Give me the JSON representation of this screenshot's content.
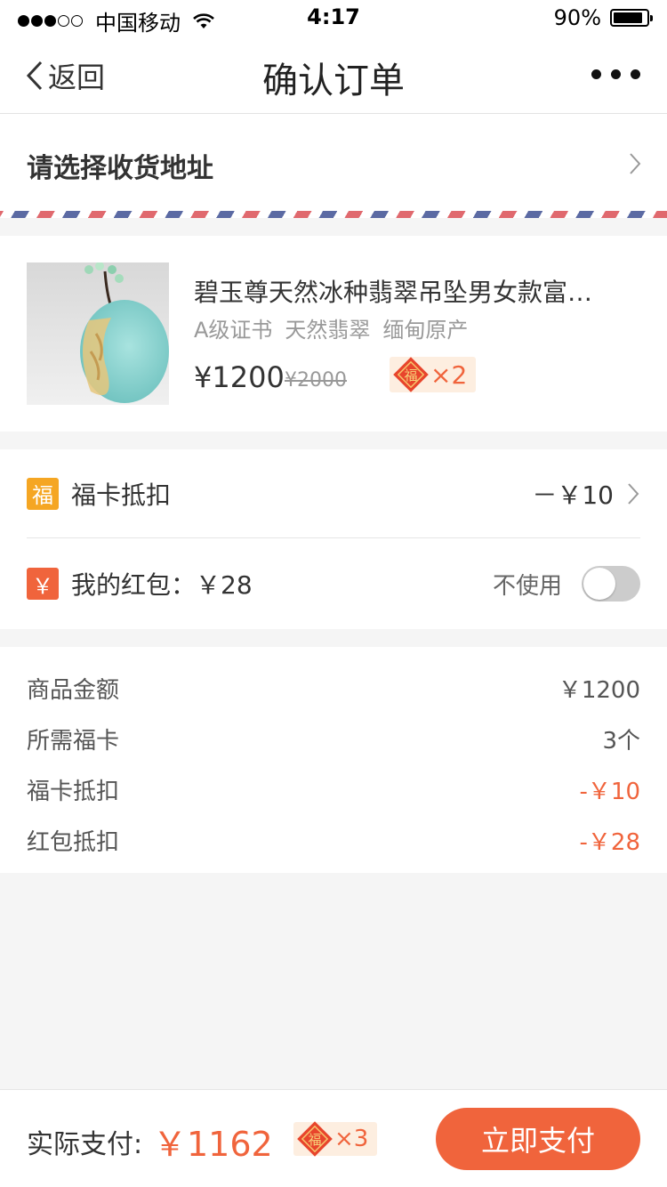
{
  "status_bar": {
    "carrier": "中国移动",
    "time": "4:17",
    "battery": "90%",
    "battery_level": 0.9
  },
  "nav": {
    "back_label": "返回",
    "title": "确认订单"
  },
  "address": {
    "label": "请选择收货地址"
  },
  "product": {
    "name": "碧玉尊天然冰种翡翠吊坠男女款富贵豆",
    "tags": [
      "A级证书",
      "天然翡翠",
      "缅甸原产"
    ],
    "price": "¥1200",
    "original_price": "¥2000",
    "fu_badge_char": "福",
    "fu_count": "×2"
  },
  "discounts": {
    "fuka": {
      "icon_char": "福",
      "label": "福卡抵扣",
      "amount": "－￥10"
    },
    "hongbao": {
      "icon_char": "￥",
      "label": "我的红包：￥28",
      "toggle_label": "不使用",
      "toggle_on": false
    }
  },
  "summary": {
    "rows": [
      {
        "label": "商品金额",
        "value": "￥1200",
        "highlight": false
      },
      {
        "label": "所需福卡",
        "value": "3个",
        "highlight": false
      },
      {
        "label": "福卡抵扣",
        "value": "-￥10",
        "highlight": true
      },
      {
        "label": "红包抵扣",
        "value": "-￥28",
        "highlight": true
      }
    ]
  },
  "footer": {
    "pay_label": "实际支付:",
    "pay_total": "￥1162",
    "fu_badge_char": "福",
    "fu_count": "×3",
    "pay_button": "立即支付"
  },
  "colors": {
    "accent": "#f0643c",
    "fuka_icon": "#f5a623",
    "airmail_red": "#e0696e",
    "airmail_blue": "#5b6aa3"
  },
  "icons": [
    "back-chevron-icon",
    "more-icon",
    "chevron-right-icon",
    "wifi-icon",
    "battery-icon",
    "fu-diamond-icon",
    "fuka-icon",
    "hongbao-icon"
  ]
}
